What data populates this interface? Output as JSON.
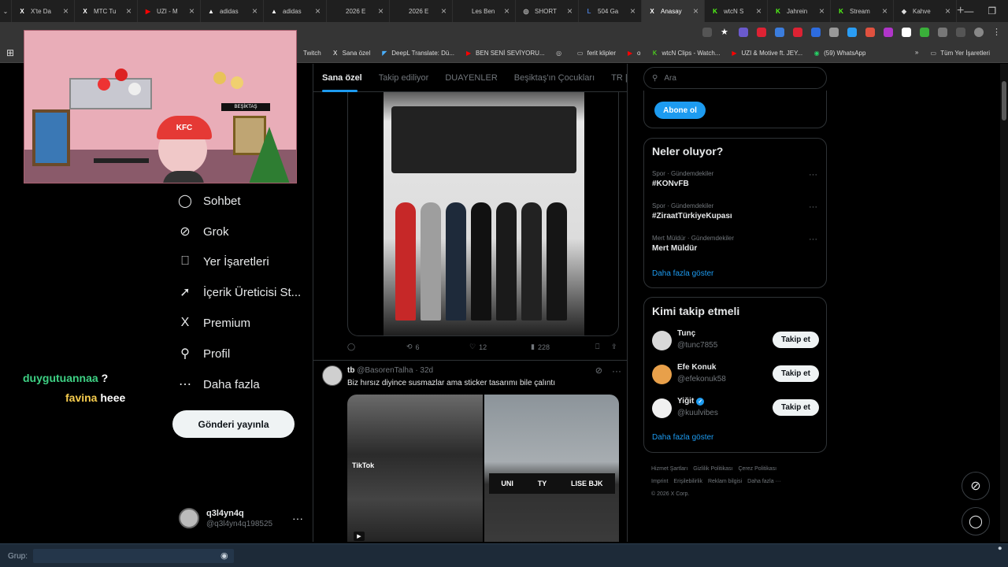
{
  "browser": {
    "tabs": [
      {
        "title": "X'te Da",
        "icon": "x-logo-icon",
        "color": "#ffffff",
        "glyph": "X",
        "active": false
      },
      {
        "title": "MTC Tu",
        "icon": "x-logo-icon",
        "color": "#ffffff",
        "glyph": "X",
        "active": false
      },
      {
        "title": "UZI - M",
        "icon": "youtube-icon",
        "color": "#ff0000",
        "glyph": "▶",
        "active": false
      },
      {
        "title": "adidas",
        "icon": "adidas-icon",
        "color": "#ffffff",
        "glyph": "▲",
        "active": false
      },
      {
        "title": "adidas",
        "icon": "adidas-icon",
        "color": "#ffffff",
        "glyph": "▲",
        "active": false
      },
      {
        "title": "2026 E",
        "icon": "page-icon",
        "color": "#bbbbbb",
        "glyph": "",
        "active": false
      },
      {
        "title": "2026 E",
        "icon": "page-icon",
        "color": "#bbbbbb",
        "glyph": "",
        "active": false
      },
      {
        "title": "Les Ben",
        "icon": "page-icon",
        "color": "#bbbbbb",
        "glyph": "",
        "active": false
      },
      {
        "title": "SHORT",
        "icon": "globe-icon",
        "color": "#cccccc",
        "glyph": "◎",
        "active": false
      },
      {
        "title": "504 Ga",
        "icon": "lol-icon",
        "color": "#4a7bd1",
        "glyph": "L",
        "active": false
      },
      {
        "title": "Anasay",
        "icon": "x-logo-icon",
        "color": "#ffffff",
        "glyph": "X",
        "active": true
      },
      {
        "title": "wtcN S",
        "icon": "kick-icon",
        "color": "#53fc18",
        "glyph": "K",
        "active": false
      },
      {
        "title": "Jahrein",
        "icon": "kick-icon",
        "color": "#53fc18",
        "glyph": "K",
        "active": false
      },
      {
        "title": "Stream",
        "icon": "kick-icon",
        "color": "#53fc18",
        "glyph": "K",
        "active": false
      },
      {
        "title": "Kahve",
        "icon": "diamond-icon",
        "color": "#dddddd",
        "glyph": "◆",
        "active": false
      }
    ],
    "bookmarks": [
      {
        "label": "Twitch",
        "icon": "twitch-icon",
        "color": "#9146ff",
        "glyph": ""
      },
      {
        "label": "Sana özel",
        "icon": "x-logo-icon",
        "color": "#ffffff",
        "glyph": "X"
      },
      {
        "label": "DeepL Translate: Dü...",
        "icon": "deepl-icon",
        "color": "#4ab0ff",
        "glyph": "◤"
      },
      {
        "label": "BEN SENİ SEVİYORU...",
        "icon": "youtube-icon",
        "color": "#ff0000",
        "glyph": "▶"
      },
      {
        "label": "",
        "icon": "globe-icon",
        "color": "#cccccc",
        "glyph": "◎"
      },
      {
        "label": "ferit klipler",
        "icon": "folder-icon",
        "color": "#cccccc",
        "glyph": "▭"
      },
      {
        "label": "o",
        "icon": "youtube-icon",
        "color": "#ff0000",
        "glyph": "▶"
      },
      {
        "label": "wtcN Clips - Watch...",
        "icon": "kick-icon",
        "color": "#53fc18",
        "glyph": "K"
      },
      {
        "label": "UZI & Motive ft. JEY...",
        "icon": "youtube-icon",
        "color": "#ff0000",
        "glyph": "▶"
      },
      {
        "label": "(59) WhatsApp",
        "icon": "whatsapp-icon",
        "color": "#25d366",
        "glyph": "◉"
      }
    ],
    "bookmarks_more": "»",
    "all_bookmarks": "Tüm Yer İşaretleri"
  },
  "chat": {
    "line1_user": "duygutuannaa",
    "line1_msg": "?",
    "line2_user": "favina",
    "line2_msg": "heee"
  },
  "stream_overlay": {
    "hat_text": "KFC",
    "sign_text": "BEŞİKTAŞ"
  },
  "nav": {
    "items": [
      {
        "label": "Sohbet",
        "icon": "chat-icon",
        "glyph": "◯"
      },
      {
        "label": "Grok",
        "icon": "grok-icon",
        "glyph": "⊘"
      },
      {
        "label": "Yer İşaretleri",
        "icon": "bookmark-icon",
        "glyph": "⎕"
      },
      {
        "label": "İçerik Üreticisi St...",
        "icon": "rocket-icon",
        "glyph": "➚"
      },
      {
        "label": "Premium",
        "icon": "x-logo-icon",
        "glyph": "X"
      },
      {
        "label": "Profil",
        "icon": "person-icon",
        "glyph": "⚲"
      },
      {
        "label": "Daha fazla",
        "icon": "more-circle-icon",
        "glyph": "⋯"
      }
    ],
    "post_button": "Gönderi yayınla",
    "account_name": "q3l4yn4q",
    "account_handle": "@q3l4yn4q198525",
    "account_more": "···"
  },
  "timeline": {
    "tabs": [
      "Sana özel",
      "Takip ediliyor",
      "DUAYENLER",
      "Beşiktaş'ın Çocukları",
      "TR | VAL"
    ],
    "post1_actions": {
      "replies": "",
      "reposts": "6",
      "likes": "12",
      "views": "228"
    },
    "post2": {
      "name": "tb",
      "handle": "@BasorenTalha",
      "time": "· 32d",
      "text": "Biz hırsız diyince susmazlar ama sticker tasarımı bile çalıntı",
      "tiktok_label": "TikTok",
      "banner_left": "UNI",
      "banner_mid": "TY",
      "banner_right": "LISE BJK"
    }
  },
  "sidebar": {
    "search_placeholder": "Ara",
    "subscribe": "Abone ol",
    "trends_title": "Neler oluyor?",
    "trends": [
      {
        "category": "Spor · Gündemdekiler",
        "name": "#KONvFB"
      },
      {
        "category": "Spor · Gündemdekiler",
        "name": "#ZiraatTürkiyeKupası"
      },
      {
        "category": "Mert Müldür · Gündemdekiler",
        "name": "Mert Müldür"
      }
    ],
    "trends_more": "Daha fazla göster",
    "who_title": "Kimi takip etmeli",
    "who": [
      {
        "name": "Tunç",
        "handle": "@tunc7855",
        "button": "Takip et",
        "verified": false,
        "avatar_color": "#d9d9d9"
      },
      {
        "name": "Efe Konuk",
        "handle": "@efekonuk58",
        "button": "Takip et",
        "verified": false,
        "avatar_color": "#e8a04a"
      },
      {
        "name": "Yiğit",
        "handle": "@kuulvibes",
        "button": "Takip et",
        "verified": true,
        "avatar_color": "#f0f0f0"
      }
    ],
    "who_more": "Daha fazla göster",
    "footer": [
      "Hizmet Şartları",
      "Gizlilik Politikası",
      "Çerez Politikası",
      "Imprint",
      "Erişilebilirlik",
      "Reklam bilgisi",
      "Daha fazla ···",
      "© 2026 X Corp."
    ]
  },
  "bottom": {
    "group_label": "Grup:"
  },
  "colors": {
    "accent": "#1d9bf0",
    "chat_user1": "#3ed184",
    "chat_user2": "#f7cd4e"
  }
}
